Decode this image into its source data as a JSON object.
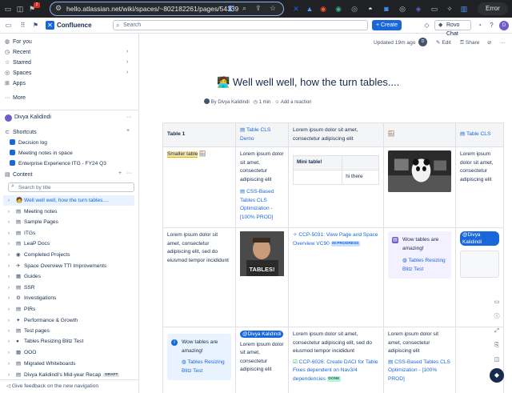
{
  "browser": {
    "url": "hello.atlassian.net/wiki/spaces/~802182261/pages/54339",
    "error_label": "Error",
    "notification_count": "2"
  },
  "topbar": {
    "brand": "Confluence",
    "search_placeholder": "Search",
    "create_label": "+ Create",
    "rovo_label": "Rovo Chat"
  },
  "sidebar": {
    "nav": [
      {
        "label": "For you",
        "icon": "home-icon"
      },
      {
        "label": "Recent",
        "icon": "clock-icon"
      },
      {
        "label": "Starred",
        "icon": "star-icon"
      },
      {
        "label": "Spaces",
        "icon": "globe-icon"
      },
      {
        "label": "Apps",
        "icon": "apps-icon"
      }
    ],
    "more_label": "More",
    "space_owner": "Divya Kalidindi",
    "shortcuts_label": "Shortcuts",
    "shortcuts": [
      "Decision log",
      "Meeting notes in space",
      "Enterprise Experience ITG - FY24 Q3"
    ],
    "content_label": "Content",
    "search_placeholder": "Search by title",
    "tree": [
      {
        "label": "Well well well, how the turn tables....",
        "icon": "🧑",
        "active": true
      },
      {
        "label": "Meeting notes",
        "icon": "▤"
      },
      {
        "label": "Sample Pages",
        "icon": "▤"
      },
      {
        "label": "ITGs",
        "icon": "▤"
      },
      {
        "label": "LeaP Docs",
        "icon": "▤"
      },
      {
        "label": "Completed Projects",
        "icon": "◉"
      },
      {
        "label": "Space Overview TTI Improvements",
        "icon": "✈"
      },
      {
        "label": "Guides",
        "icon": "▦"
      },
      {
        "label": "SSR",
        "icon": "▤"
      },
      {
        "label": "Investigations",
        "icon": "⚙"
      },
      {
        "label": "PIRs",
        "icon": "▤"
      },
      {
        "label": "Performance & Growth",
        "icon": "✦"
      },
      {
        "label": "Test pages",
        "icon": "▤"
      },
      {
        "label": "Tables Resizing Blitz Test",
        "icon": "●"
      },
      {
        "label": "OOO",
        "icon": "▦"
      },
      {
        "label": "Migrated Whiteboards",
        "icon": "▤"
      },
      {
        "label": "Divya Kalidindi's Mid-year Recap",
        "icon": "▤",
        "badge": "DRAFT"
      }
    ],
    "feedback_label": "Give feedback on the new navigation"
  },
  "page": {
    "updated": "Updated 19m ago",
    "edit_label": "Edit",
    "share_label": "Share",
    "title": "Well well well, how the turn tables....",
    "author": "By Divya Kalidindi",
    "read_time": "1 min",
    "reaction_label": "Add a reaction"
  },
  "table": {
    "header": [
      "Table 1",
      "Table CLS Demo",
      "Lorem ipsum dolor sit amet, consectetur adipiscing elit",
      "",
      "Table CLS"
    ],
    "r1": {
      "c1": "Smaller table",
      "c2_text": "Lorem ipsum dolor sit amet, consectetur adipiscing elit",
      "c2_link": "CSS-Based Tables CLS Optimization - [100% PROD]",
      "c3_inner_header": "Mini table!",
      "c3_inner_cell": "hi there",
      "c5": "Lorem ipsum dolor sit amet, consectetur adipiscing elit"
    },
    "r2": {
      "c1": "Lorem ipsum dolor sit amet, consectetur adipiscing elit, sed do eiusmod tempor incididunt",
      "c2_img_text": "TABLES!",
      "c3_link": "CCP-5031: View Page and Space Overview VC90",
      "c3_badge": "IN PROGRESS",
      "c4_panel": "Wow tables are amazing!",
      "c4_link": "Tables Resizing Blitz Test",
      "c5_mention": "@Divya Kalidindi"
    },
    "r3": {
      "c1": "Lorem ipsum dolor sit amet, consectetur adipiscing elit, sed do eiusmod tempor incididunt",
      "c1_panel": "Wow tables are amazing!",
      "c1_link": "Tables Resizing Blitz Test",
      "c2_mention": "@Divya Kalidindi",
      "c2_text": "Lorem ipsum dolor sit amet, consectetur adipiscing elit",
      "c3_text": "Lorem ipsum dolor sit amet, consectetur adipiscing elit, sed do eiusmod tempor incididunt",
      "c3_link": "CCP-6026: Create DACI for Table Fixes dependent on Nav3/4 dependencies",
      "c3_badge": "DONE",
      "c4_text": "Lorem ipsum dolor sit amet, consectetur adipiscing elit",
      "c4_link": "CSS-Based Tables CLS Optimization - [100% PROD]"
    }
  }
}
